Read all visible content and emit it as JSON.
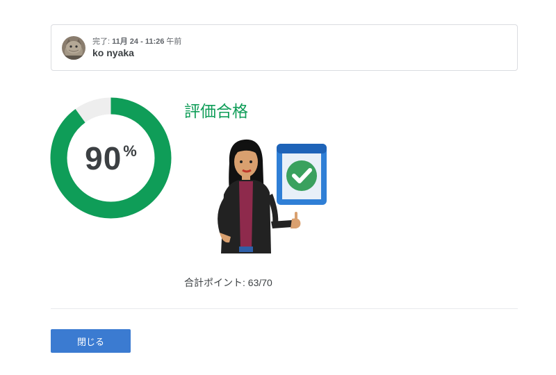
{
  "submission": {
    "status_prefix": "完了: ",
    "date": "11月 24",
    "separator": " - ",
    "time": "11:26",
    "ampm": " 午前",
    "user_name": "ko nyaka"
  },
  "score": {
    "value": "90",
    "symbol": "%",
    "fraction": 0.9,
    "color_fill": "#0f9d58",
    "color_track": "#eeeeee"
  },
  "result": {
    "title": "評価合格",
    "points_label": "合計ポイント: 63/70"
  },
  "actions": {
    "close_label": "閉じる"
  }
}
